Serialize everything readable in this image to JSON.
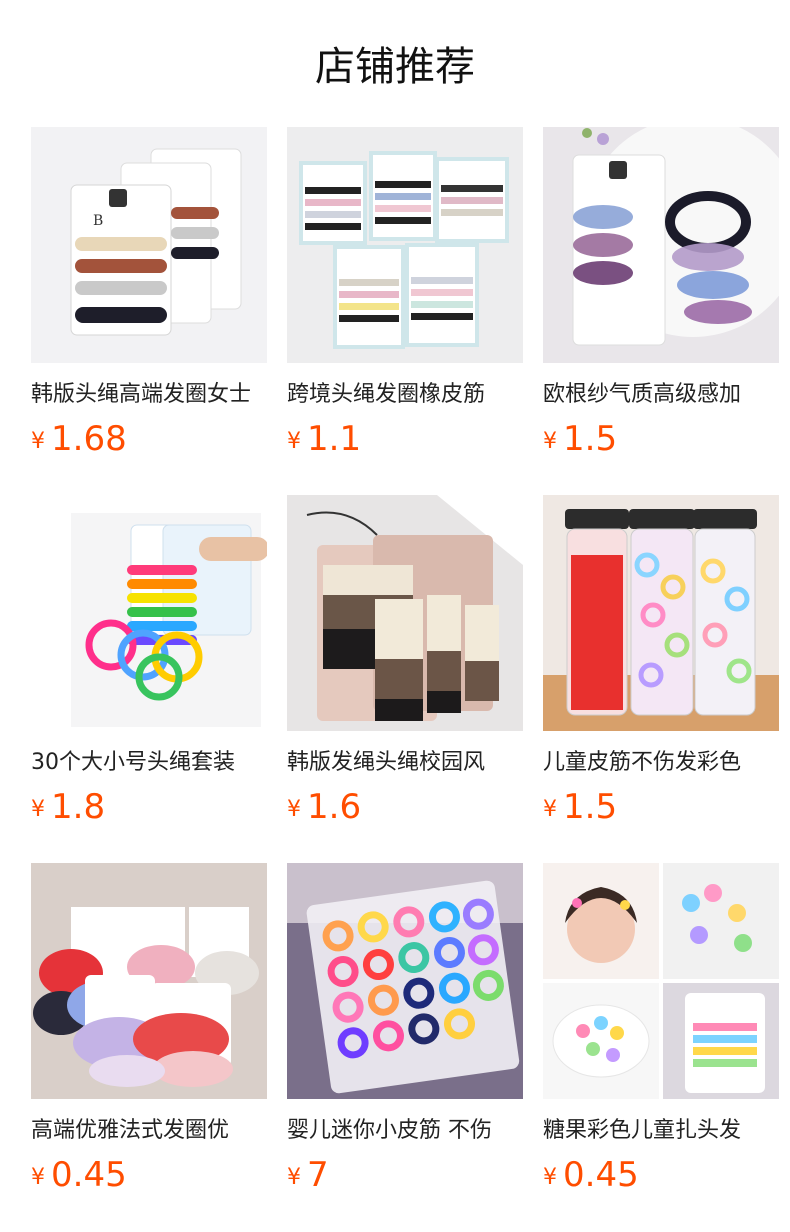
{
  "header": {
    "title": "店铺推荐"
  },
  "products": [
    {
      "name": "韩版头绳高端发圈女士",
      "currency": "¥",
      "price": "1.68"
    },
    {
      "name": "跨境头绳发圈橡皮筋",
      "currency": "¥",
      "price": "1.1"
    },
    {
      "name": "欧根纱气质高级感加",
      "currency": "¥",
      "price": "1.5"
    },
    {
      "name": "30个大小号头绳套装",
      "currency": "¥",
      "price": "1.8"
    },
    {
      "name": "韩版发绳头绳校园风",
      "currency": "¥",
      "price": "1.6"
    },
    {
      "name": "儿童皮筋不伤发彩色",
      "currency": "¥",
      "price": "1.5"
    },
    {
      "name": "高端优雅法式发圈优",
      "currency": "¥",
      "price": "0.45"
    },
    {
      "name": "婴儿迷你小皮筋 不伤",
      "currency": "¥",
      "price": "7"
    },
    {
      "name": "糖果彩色儿童扎头发",
      "currency": "¥",
      "price": "0.45"
    }
  ]
}
